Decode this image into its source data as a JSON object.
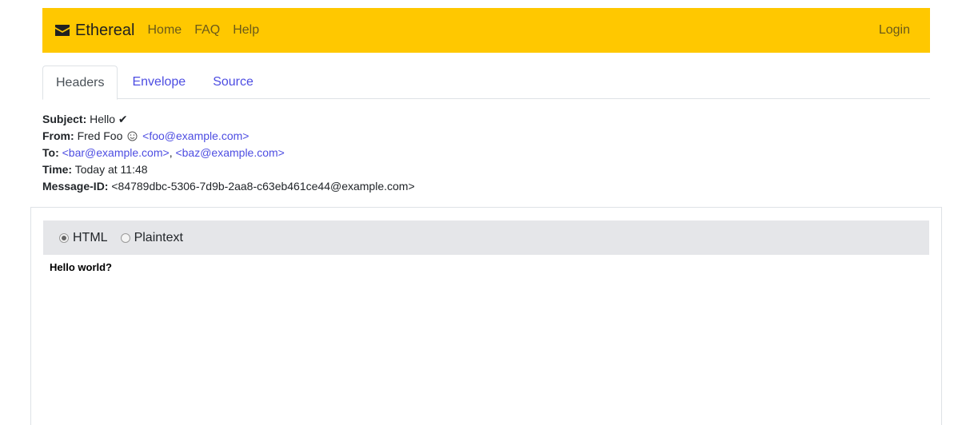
{
  "navbar": {
    "brand": "Ethereal",
    "brand_icon": "envelope-icon",
    "links": [
      "Home",
      "FAQ",
      "Help"
    ],
    "login": "Login",
    "color": "#ffc800"
  },
  "tabs": [
    {
      "label": "Headers",
      "active": true
    },
    {
      "label": "Envelope",
      "active": false
    },
    {
      "label": "Source",
      "active": false
    }
  ],
  "headers": {
    "subject_label": "Subject:",
    "subject_value": "Hello ✔",
    "from_label": "From:",
    "from_name": "Fred Foo",
    "from_icon": "smiley-icon",
    "from_email": "<foo@example.com>",
    "to_label": "To:",
    "to_email_1": "<bar@example.com>",
    "to_separator": ",",
    "to_email_2": "<baz@example.com>",
    "time_label": "Time:",
    "time_value": "Today at 11:48",
    "message_id_label": "Message-ID:",
    "message_id_value": "<84789dbc-5306-7d9b-2aa8-c63eb461ce44@example.com>"
  },
  "view": {
    "options": [
      {
        "label": "HTML",
        "checked": true
      },
      {
        "label": "Plaintext",
        "checked": false
      }
    ]
  },
  "message": {
    "body": "Hello world?"
  },
  "colors": {
    "link": "#4d4de2",
    "nav_text": "#6b5a1a",
    "viewbar_bg": "#e5e6e9"
  }
}
